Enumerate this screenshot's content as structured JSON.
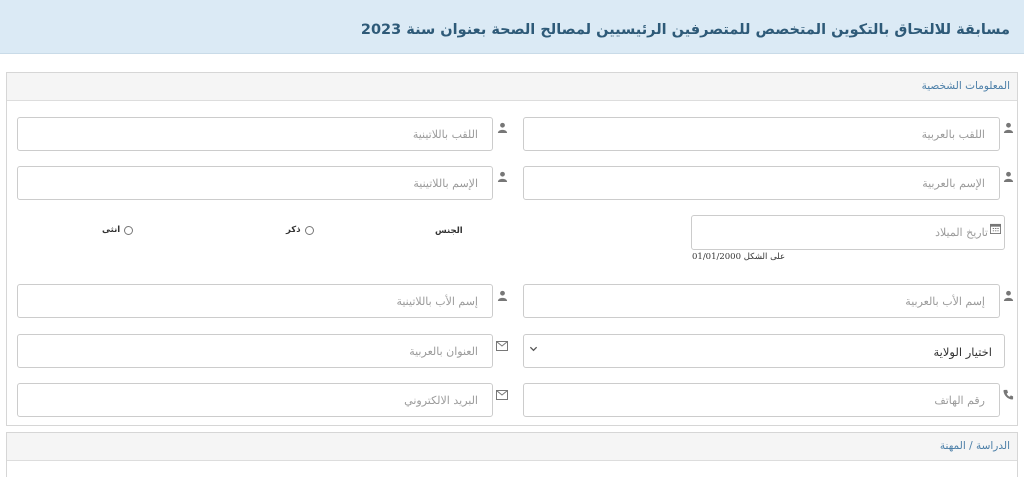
{
  "header": {
    "title": "مسابقة للالتحاق بالتكوين المتخصص للمتصرفين الرئيسيين لمصالح الصحة بعنوان سنة 2023"
  },
  "personal_section": {
    "title": "المعلومات الشخصية",
    "fields": {
      "surname_ar": {
        "placeholder": "اللقب بالعربية",
        "icon": "user-icon"
      },
      "surname_lat": {
        "placeholder": "اللقب باللاتينية",
        "icon": "user-icon"
      },
      "name_ar": {
        "placeholder": "الإسم بالعربية",
        "icon": "user-icon"
      },
      "name_lat": {
        "placeholder": "الإسم باللاتينية",
        "icon": "user-icon"
      },
      "birthdate": {
        "placeholder": "تاريخ الميلاد",
        "hint": "على الشكل 01/01/2000",
        "icon": "calendar-icon"
      },
      "gender": {
        "label": "الجنس",
        "options": [
          "ذكر",
          "انثى"
        ]
      },
      "father_ar": {
        "placeholder": "إسم الأب بالعربية",
        "icon": "user-icon"
      },
      "father_lat": {
        "placeholder": "إسم الأب باللاتينية",
        "icon": "user-icon"
      },
      "wilaya": {
        "value": "اختيار الولاية",
        "icon": "chevron-down-icon"
      },
      "address_ar": {
        "placeholder": "العنوان بالعربية",
        "icon": "envelope-icon"
      },
      "phone": {
        "placeholder": "رقم الهاتف",
        "icon": "phone-icon"
      },
      "email": {
        "placeholder": "البريد الالكتروني",
        "icon": "envelope-icon"
      }
    }
  },
  "study_section": {
    "title": "الدراسة / المهنة"
  }
}
